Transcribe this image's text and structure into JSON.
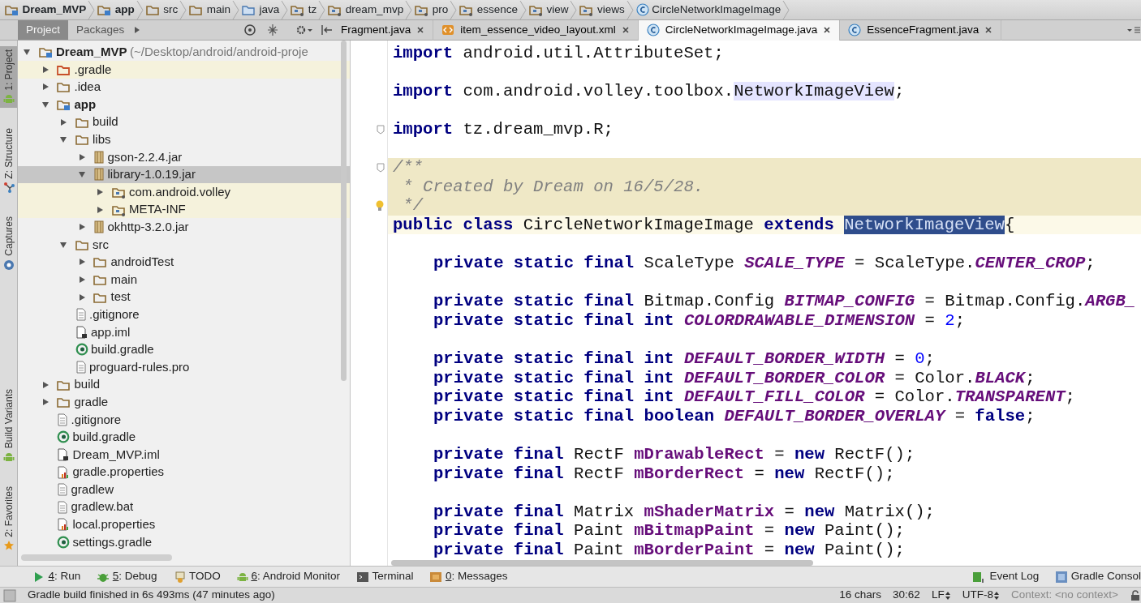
{
  "breadcrumbs": [
    {
      "label": "Dream_MVP",
      "kind": "module"
    },
    {
      "label": "app",
      "kind": "module"
    },
    {
      "label": "src",
      "kind": "folder"
    },
    {
      "label": "main",
      "kind": "folder"
    },
    {
      "label": "java",
      "kind": "source"
    },
    {
      "label": "tz",
      "kind": "package"
    },
    {
      "label": "dream_mvp",
      "kind": "package"
    },
    {
      "label": "pro",
      "kind": "package"
    },
    {
      "label": "essence",
      "kind": "package"
    },
    {
      "label": "view",
      "kind": "package"
    },
    {
      "label": "views",
      "kind": "package"
    },
    {
      "label": "CircleNetworkImageImage",
      "kind": "class"
    }
  ],
  "left_strip": {
    "top": [
      {
        "label": "1: Project",
        "selected": true,
        "kind": "android"
      },
      {
        "label": "Z: Structure",
        "selected": false,
        "kind": "structure"
      },
      {
        "label": "Captures",
        "selected": false,
        "kind": "camera"
      }
    ],
    "bottom": [
      {
        "label": "Build Variants",
        "selected": false,
        "kind": "android"
      },
      {
        "label": "2: Favorites",
        "selected": false,
        "kind": "star"
      }
    ]
  },
  "project_panel": {
    "tabs": [
      {
        "label": "Project",
        "selected": true
      },
      {
        "label": "Packages",
        "selected": false
      }
    ],
    "tree": [
      {
        "label": "Dream_MVP",
        "path": "(~/Desktop/android/android-proje",
        "kind": "module",
        "expanded": true,
        "selected": false,
        "highlighted": false,
        "children": [
          {
            "label": ".gradle",
            "kind": "excluded",
            "expanded": false,
            "selected": false,
            "highlighted": true
          },
          {
            "label": ".idea",
            "kind": "folder",
            "expanded": false,
            "selected": false,
            "highlighted": false
          },
          {
            "label": "app",
            "kind": "module",
            "expanded": true,
            "selected": false,
            "highlighted": false,
            "children": [
              {
                "label": "build",
                "kind": "folder",
                "expanded": false,
                "selected": false,
                "highlighted": false
              },
              {
                "label": "libs",
                "kind": "folder",
                "expanded": true,
                "selected": false,
                "highlighted": false,
                "children": [
                  {
                    "label": "gson-2.2.4.jar",
                    "kind": "jar",
                    "expanded": false,
                    "selected": false,
                    "highlighted": false
                  },
                  {
                    "label": "library-1.0.19.jar",
                    "kind": "jar",
                    "expanded": true,
                    "selected": true,
                    "highlighted": false,
                    "children": [
                      {
                        "label": "com.android.volley",
                        "kind": "package",
                        "expanded": false,
                        "selected": false,
                        "highlighted": true
                      },
                      {
                        "label": "META-INF",
                        "kind": "package",
                        "expanded": false,
                        "selected": false,
                        "highlighted": true
                      }
                    ]
                  },
                  {
                    "label": "okhttp-3.2.0.jar",
                    "kind": "jar",
                    "expanded": false,
                    "selected": false,
                    "highlighted": false
                  }
                ]
              },
              {
                "label": "src",
                "kind": "folder",
                "expanded": true,
                "selected": false,
                "highlighted": false,
                "children": [
                  {
                    "label": "androidTest",
                    "kind": "folder",
                    "expanded": false,
                    "selected": false,
                    "highlighted": false
                  },
                  {
                    "label": "main",
                    "kind": "folder",
                    "expanded": false,
                    "selected": false,
                    "highlighted": false
                  },
                  {
                    "label": "test",
                    "kind": "folder",
                    "expanded": false,
                    "selected": false,
                    "highlighted": false
                  }
                ]
              },
              {
                "label": ".gitignore",
                "kind": "file",
                "selected": false,
                "highlighted": false
              },
              {
                "label": "app.iml",
                "kind": "iml",
                "selected": false,
                "highlighted": false
              },
              {
                "label": "build.gradle",
                "kind": "gradle",
                "selected": false,
                "highlighted": false
              },
              {
                "label": "proguard-rules.pro",
                "kind": "file",
                "selected": false,
                "highlighted": false
              }
            ]
          },
          {
            "label": "build",
            "kind": "folder",
            "expanded": false,
            "selected": false,
            "highlighted": false
          },
          {
            "label": "gradle",
            "kind": "folder",
            "expanded": false,
            "selected": false,
            "highlighted": false
          },
          {
            "label": ".gitignore",
            "kind": "file",
            "selected": false,
            "highlighted": false
          },
          {
            "label": "build.gradle",
            "kind": "gradle",
            "selected": false,
            "highlighted": false
          },
          {
            "label": "Dream_MVP.iml",
            "kind": "iml",
            "selected": false,
            "highlighted": false
          },
          {
            "label": "gradle.properties",
            "kind": "props",
            "selected": false,
            "highlighted": false
          },
          {
            "label": "gradlew",
            "kind": "file",
            "selected": false,
            "highlighted": false
          },
          {
            "label": "gradlew.bat",
            "kind": "file",
            "selected": false,
            "highlighted": false
          },
          {
            "label": "local.properties",
            "kind": "props",
            "selected": false,
            "highlighted": false
          },
          {
            "label": "settings.gradle",
            "kind": "gradle",
            "selected": false,
            "highlighted": false
          }
        ]
      }
    ]
  },
  "editor_tabs": [
    {
      "label": "Fragment.java",
      "kind": "plain",
      "selected": false
    },
    {
      "label": "item_essence_video_layout.xml",
      "kind": "xml",
      "selected": false
    },
    {
      "label": "CircleNetworkImageImage.java",
      "kind": "class",
      "selected": true
    },
    {
      "label": "EssenceFragment.java",
      "kind": "class",
      "selected": false
    }
  ],
  "code": [
    {
      "kind": "code",
      "indented": false,
      "tokens": [
        {
          "kind": "kw",
          "text": "import"
        },
        {
          "kind": "plain",
          "text": " android.util.AttributeSet;"
        }
      ]
    },
    {
      "kind": "blank"
    },
    {
      "kind": "code",
      "indented": false,
      "tokens": [
        {
          "kind": "kw",
          "text": "import"
        },
        {
          "kind": "plain",
          "text": " com.android.volley.toolbox."
        },
        {
          "kind": "ref",
          "text": "NetworkImageView"
        },
        {
          "kind": "plain",
          "text": ";"
        }
      ]
    },
    {
      "kind": "blank"
    },
    {
      "kind": "code",
      "indented": false,
      "fold": true,
      "tokens": [
        {
          "kind": "kw",
          "text": "import"
        },
        {
          "kind": "plain",
          "text": " tz.dream_mvp.R;"
        }
      ]
    },
    {
      "kind": "blank"
    },
    {
      "kind": "doc",
      "indented": false,
      "fold": true,
      "tokens": [
        {
          "kind": "comment",
          "text": "/**"
        }
      ]
    },
    {
      "kind": "doc",
      "indented": false,
      "tokens": [
        {
          "kind": "comment",
          "text": " * Created by Dream on 16/5/28."
        }
      ]
    },
    {
      "kind": "doc",
      "indented": false,
      "bulb": true,
      "tokens": [
        {
          "kind": "comment",
          "text": " */"
        }
      ]
    },
    {
      "kind": "current",
      "indented": false,
      "tokens": [
        {
          "kind": "kw",
          "text": "public class"
        },
        {
          "kind": "plain",
          "text": " CircleNetworkImageImage "
        },
        {
          "kind": "kw",
          "text": "extends "
        },
        {
          "kind": "sel",
          "text": "NetworkImageView"
        },
        {
          "kind": "plain",
          "text": "{"
        }
      ]
    },
    {
      "kind": "blank"
    },
    {
      "kind": "code",
      "indented": true,
      "tokens": [
        {
          "kind": "kw",
          "text": "private static final"
        },
        {
          "kind": "plain",
          "text": " ScaleType "
        },
        {
          "kind": "const",
          "text": "SCALE_TYPE"
        },
        {
          "kind": "plain",
          "text": " = ScaleType."
        },
        {
          "kind": "const",
          "text": "CENTER_CROP"
        },
        {
          "kind": "plain",
          "text": ";"
        }
      ]
    },
    {
      "kind": "blank"
    },
    {
      "kind": "code",
      "indented": true,
      "tokens": [
        {
          "kind": "kw",
          "text": "private static final"
        },
        {
          "kind": "plain",
          "text": " Bitmap.Config "
        },
        {
          "kind": "const",
          "text": "BITMAP_CONFIG"
        },
        {
          "kind": "plain",
          "text": " = Bitmap.Config."
        },
        {
          "kind": "const",
          "text": "ARGB_"
        }
      ]
    },
    {
      "kind": "code",
      "indented": true,
      "tokens": [
        {
          "kind": "kw",
          "text": "private static final int "
        },
        {
          "kind": "const",
          "text": "COLORDRAWABLE_DIMENSION"
        },
        {
          "kind": "plain",
          "text": " = "
        },
        {
          "kind": "num",
          "text": "2"
        },
        {
          "kind": "plain",
          "text": ";"
        }
      ]
    },
    {
      "kind": "blank"
    },
    {
      "kind": "code",
      "indented": true,
      "tokens": [
        {
          "kind": "kw",
          "text": "private static final int "
        },
        {
          "kind": "const",
          "text": "DEFAULT_BORDER_WIDTH"
        },
        {
          "kind": "plain",
          "text": " = "
        },
        {
          "kind": "num",
          "text": "0"
        },
        {
          "kind": "plain",
          "text": ";"
        }
      ]
    },
    {
      "kind": "code",
      "indented": true,
      "tokens": [
        {
          "kind": "kw",
          "text": "private static final int "
        },
        {
          "kind": "const",
          "text": "DEFAULT_BORDER_COLOR"
        },
        {
          "kind": "plain",
          "text": " = Color."
        },
        {
          "kind": "const",
          "text": "BLACK"
        },
        {
          "kind": "plain",
          "text": ";"
        }
      ]
    },
    {
      "kind": "code",
      "indented": true,
      "tokens": [
        {
          "kind": "kw",
          "text": "private static final int "
        },
        {
          "kind": "const",
          "text": "DEFAULT_FILL_COLOR"
        },
        {
          "kind": "plain",
          "text": " = Color."
        },
        {
          "kind": "const",
          "text": "TRANSPARENT"
        },
        {
          "kind": "plain",
          "text": ";"
        }
      ]
    },
    {
      "kind": "code",
      "indented": true,
      "tokens": [
        {
          "kind": "kw",
          "text": "private static final boolean "
        },
        {
          "kind": "const",
          "text": "DEFAULT_BORDER_OVERLAY"
        },
        {
          "kind": "plain",
          "text": " = "
        },
        {
          "kind": "kw",
          "text": "false"
        },
        {
          "kind": "plain",
          "text": ";"
        }
      ]
    },
    {
      "kind": "blank"
    },
    {
      "kind": "code",
      "indented": true,
      "tokens": [
        {
          "kind": "kw",
          "text": "private final"
        },
        {
          "kind": "plain",
          "text": " RectF "
        },
        {
          "kind": "field",
          "text": "mDrawableRect"
        },
        {
          "kind": "plain",
          "text": " = "
        },
        {
          "kind": "kw",
          "text": "new"
        },
        {
          "kind": "plain",
          "text": " RectF();"
        }
      ]
    },
    {
      "kind": "code",
      "indented": true,
      "tokens": [
        {
          "kind": "kw",
          "text": "private final"
        },
        {
          "kind": "plain",
          "text": " RectF "
        },
        {
          "kind": "field",
          "text": "mBorderRect"
        },
        {
          "kind": "plain",
          "text": " = "
        },
        {
          "kind": "kw",
          "text": "new"
        },
        {
          "kind": "plain",
          "text": " RectF();"
        }
      ]
    },
    {
      "kind": "blank"
    },
    {
      "kind": "code",
      "indented": true,
      "tokens": [
        {
          "kind": "kw",
          "text": "private final"
        },
        {
          "kind": "plain",
          "text": " Matrix "
        },
        {
          "kind": "field",
          "text": "mShaderMatrix"
        },
        {
          "kind": "plain",
          "text": " = "
        },
        {
          "kind": "kw",
          "text": "new"
        },
        {
          "kind": "plain",
          "text": " Matrix();"
        }
      ]
    },
    {
      "kind": "code",
      "indented": true,
      "tokens": [
        {
          "kind": "kw",
          "text": "private final"
        },
        {
          "kind": "plain",
          "text": " Paint "
        },
        {
          "kind": "field",
          "text": "mBitmapPaint"
        },
        {
          "kind": "plain",
          "text": " = "
        },
        {
          "kind": "kw",
          "text": "new"
        },
        {
          "kind": "plain",
          "text": " Paint();"
        }
      ]
    },
    {
      "kind": "code",
      "indented": true,
      "tokens": [
        {
          "kind": "kw",
          "text": "private final"
        },
        {
          "kind": "plain",
          "text": " Paint "
        },
        {
          "kind": "field",
          "text": "mBorderPaint"
        },
        {
          "kind": "plain",
          "text": " = "
        },
        {
          "kind": "kw",
          "text": "new"
        },
        {
          "kind": "plain",
          "text": " Paint();"
        }
      ]
    }
  ],
  "tool_buttons": {
    "left": [
      {
        "key": "4",
        "label": ": Run",
        "kind": "run"
      },
      {
        "key": "5",
        "label": ": Debug",
        "kind": "bug"
      },
      {
        "label": "TODO",
        "kind": "todo"
      },
      {
        "key": "6",
        "label": ": Android Monitor",
        "kind": "android"
      },
      {
        "label": "Terminal",
        "kind": "terminal"
      },
      {
        "key": "0",
        "label": ": Messages",
        "kind": "messages"
      }
    ],
    "right": [
      {
        "label": "Event Log",
        "kind": "log"
      },
      {
        "label": "Gradle Consol",
        "kind": "console"
      }
    ]
  },
  "status_bar": {
    "message": "Gradle build finished in 6s 493ms (47 minutes ago)",
    "chars": "16 chars",
    "position": "30:62",
    "line_separator": "LF",
    "encoding": "UTF-8",
    "context": "Context: <no context>"
  }
}
